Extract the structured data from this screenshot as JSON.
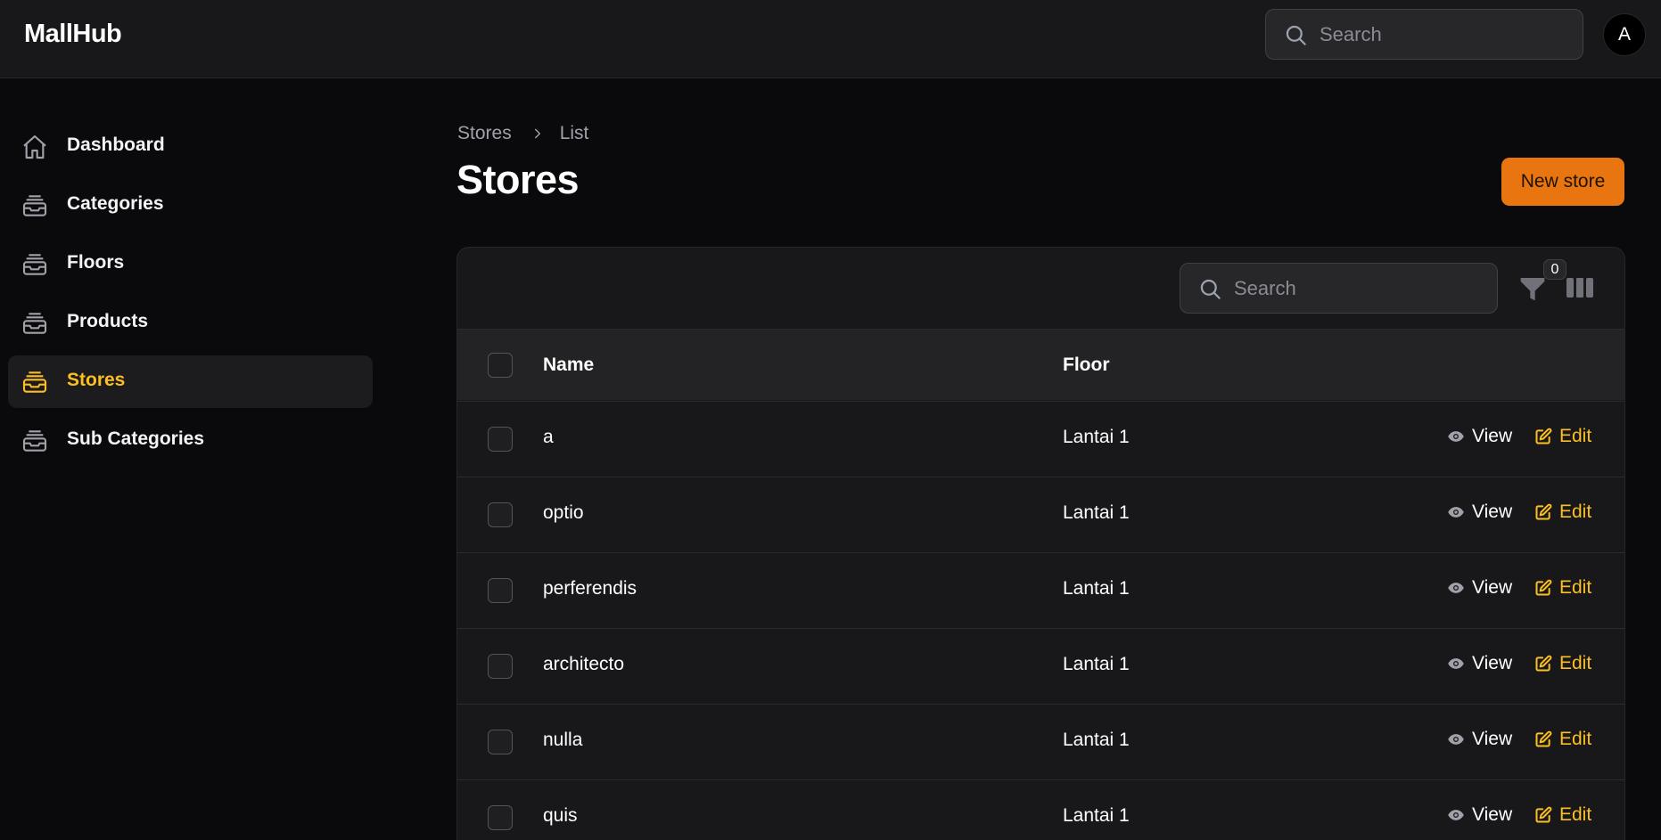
{
  "app": {
    "brand": "MallHub"
  },
  "header": {
    "search_placeholder": "Search",
    "avatar_initial": "A"
  },
  "sidebar": {
    "items": [
      {
        "label": "Dashboard",
        "icon": "home-icon",
        "active": false
      },
      {
        "label": "Categories",
        "icon": "inbox-stack-icon",
        "active": false
      },
      {
        "label": "Floors",
        "icon": "inbox-stack-icon",
        "active": false
      },
      {
        "label": "Products",
        "icon": "inbox-stack-icon",
        "active": false
      },
      {
        "label": "Stores",
        "icon": "inbox-stack-icon",
        "active": true
      },
      {
        "label": "Sub Categories",
        "icon": "inbox-stack-icon",
        "active": false
      }
    ]
  },
  "breadcrumb": {
    "parent": "Stores",
    "current": "List"
  },
  "page": {
    "title": "Stores",
    "new_button": "New store"
  },
  "table": {
    "search_placeholder": "Search",
    "filter_count": "0",
    "columns": {
      "name": "Name",
      "floor": "Floor"
    },
    "actions": {
      "view": "View",
      "edit": "Edit"
    },
    "rows": [
      {
        "name": "a",
        "floor": "Lantai 1"
      },
      {
        "name": "optio",
        "floor": "Lantai 1"
      },
      {
        "name": "perferendis",
        "floor": "Lantai 1"
      },
      {
        "name": "architecto",
        "floor": "Lantai 1"
      },
      {
        "name": "nulla",
        "floor": "Lantai 1"
      },
      {
        "name": "quis",
        "floor": "Lantai 1"
      }
    ]
  },
  "colors": {
    "accent": "#fbbf24",
    "primary_button": "#e8750f",
    "background": "#0a0a0c",
    "surface": "#18181b"
  }
}
